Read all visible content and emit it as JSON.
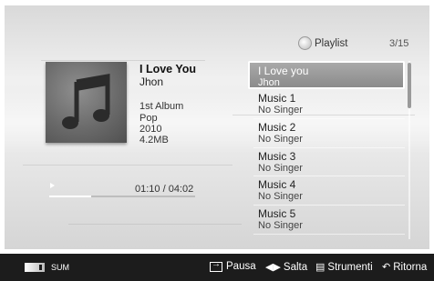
{
  "playlist": {
    "header": "Playlist",
    "counter": "3/15",
    "items": [
      {
        "title": "I Love you",
        "artist": "Jhon"
      },
      {
        "title": "Music 1",
        "artist": "No Singer"
      },
      {
        "title": "Music 2",
        "artist": "No Singer"
      },
      {
        "title": "Music 3",
        "artist": "No Singer"
      },
      {
        "title": "Music 4",
        "artist": "No Singer"
      },
      {
        "title": "Music 5",
        "artist": "No Singer"
      }
    ]
  },
  "now_playing": {
    "title": "I Love You",
    "artist": "Jhon",
    "album": "1st Album",
    "genre": "Pop",
    "year": "2010",
    "size": "4.2MB",
    "time": "01:10 / 04:02",
    "progress_fraction": 0.29
  },
  "bottom_bar": {
    "sum_label": "SUM",
    "pause_label": "Pausa",
    "skip_label": "Salta",
    "tools_label": "Strumenti",
    "return_label": "Ritorna"
  },
  "icons": [
    "music-note-icon",
    "play-icon",
    "playlist-icon",
    "enter-icon",
    "left-right-arrow-icon",
    "tools-icon",
    "return-icon",
    "sum-icon"
  ]
}
